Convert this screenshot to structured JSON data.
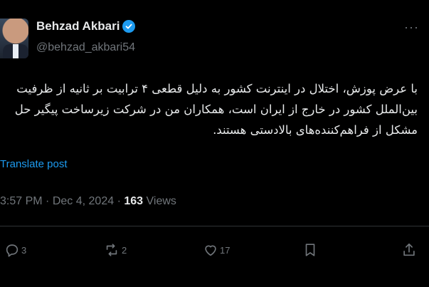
{
  "author": {
    "name": "Behzad Akbari",
    "handle": "@behzad_akbari54"
  },
  "tweet": {
    "line1": "با عرض پوزش، اختلال در اینترنت کشور به دلیل قطعی ۴ ترابیت بر ثانیه از ظرفیت",
    "line2": "بین‌الملل کشور در خارج از ایران است، همکاران من در شرکت زیرساخت پیگیر حل",
    "line3": "مشکل از فراهم‌کننده‌های بالادستی هستند."
  },
  "translate_label": "Translate post",
  "meta": {
    "time": "3:57 PM",
    "separator": "·",
    "date": "Dec 4, 2024",
    "views_count": "163",
    "views_label": "Views"
  },
  "actions": {
    "replies": "3",
    "reposts": "2",
    "likes": "17"
  },
  "colors": {
    "background": "#000000",
    "text": "#e7e9ea",
    "muted": "#71767b",
    "accent": "#1d9bf0",
    "divider": "#2f3336"
  }
}
